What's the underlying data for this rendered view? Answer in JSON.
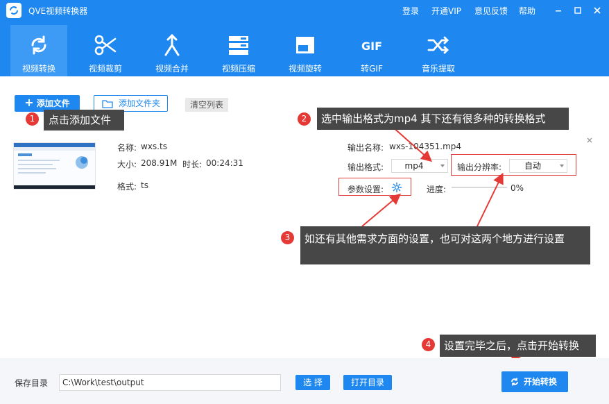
{
  "window": {
    "title": "QVE视频转换器",
    "links": [
      "登录",
      "开通VIP",
      "意见反馈",
      "帮助"
    ]
  },
  "toolbar": {
    "tools": [
      {
        "label": "视频转换",
        "icon": "convert-icon",
        "active": true
      },
      {
        "label": "视频裁剪",
        "icon": "scissors-icon"
      },
      {
        "label": "视频合并",
        "icon": "merge-icon"
      },
      {
        "label": "视频压缩",
        "icon": "compress-icon"
      },
      {
        "label": "视频旋转",
        "icon": "rotate-icon"
      },
      {
        "label": "转GIF",
        "icon": "gif-icon"
      },
      {
        "label": "音乐提取",
        "icon": "shuffle-icon"
      }
    ]
  },
  "actions": {
    "add_file": "添加文件",
    "add_folder": "添加文件夹",
    "clear_list": "清空列表"
  },
  "file": {
    "name_label": "名称:",
    "name": "wxs.ts",
    "size_label": "大小:",
    "size": "208.91M",
    "duration_label": "时长:",
    "duration": "00:24:31",
    "format_label": "格式:",
    "format": "ts",
    "output_name_label": "输出名称:",
    "output_name": "wxs-104351.mp4",
    "output_format_label": "输出格式:",
    "output_format": "mp4",
    "resolution_label": "输出分辨率:",
    "resolution": "自动",
    "params_label": "参数设置:",
    "progress_label": "进度:",
    "progress_text": "0%",
    "progress": 0
  },
  "annotations": [
    {
      "num": "1",
      "text": "点击添加文件"
    },
    {
      "num": "2",
      "text": "选中输出格式为mp4 其下还有很多种的转换格式"
    },
    {
      "num": "3",
      "text": "如还有其他需求方面的设置，也可对这两个地方进行设置"
    },
    {
      "num": "4",
      "text": "设置完毕之后，点击开始转换"
    }
  ],
  "footer": {
    "save_dir_label": "保存目录",
    "save_path": "C:\\Work\\test\\output",
    "choose": "选 择",
    "open_dir": "打开目录",
    "start": "开始转换"
  },
  "colors": {
    "primary": "#1e88f0",
    "tool_active": "#3e9bf5",
    "callout_bg": "#474747",
    "annotation_red": "#e53935"
  }
}
